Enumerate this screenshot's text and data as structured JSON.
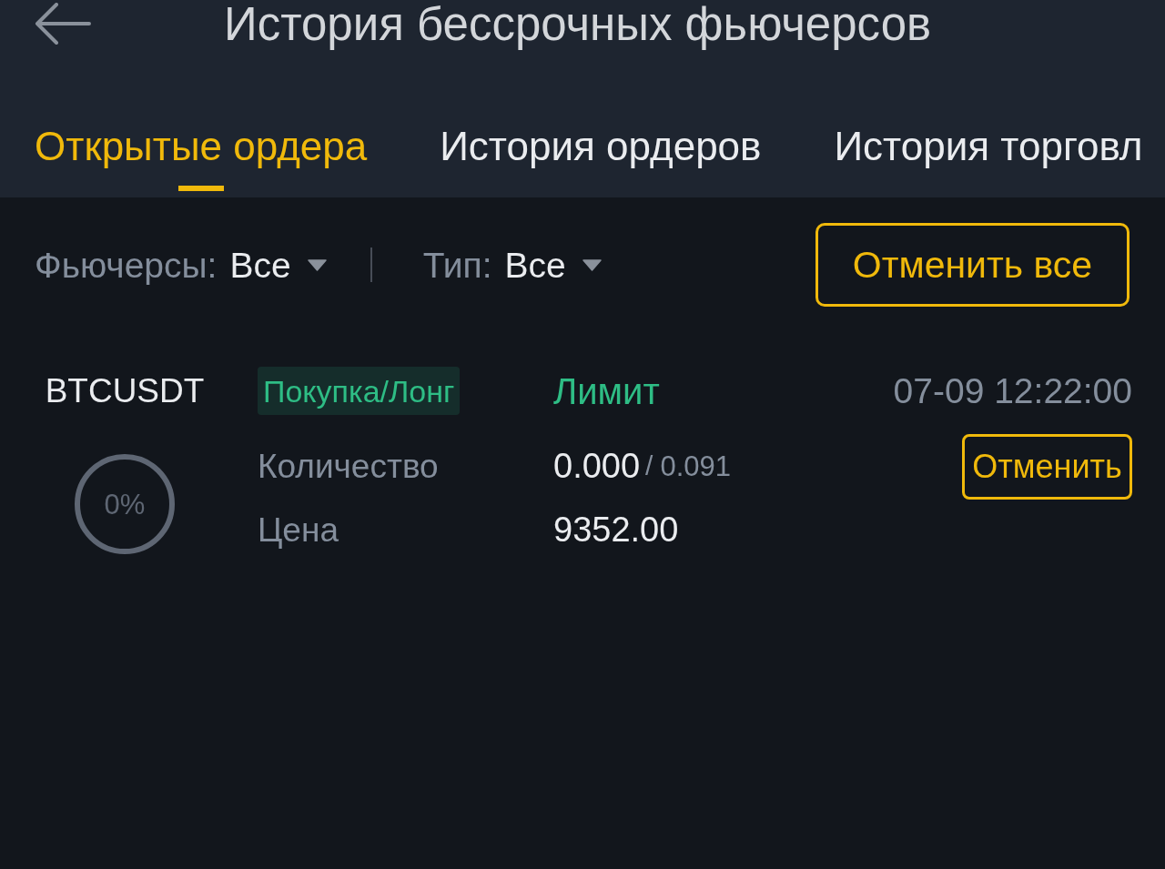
{
  "header": {
    "title": "История бессрочных фьючерсов"
  },
  "tabs": [
    {
      "label": "Открытые ордера",
      "selected": true
    },
    {
      "label": "История ордеров",
      "selected": false
    },
    {
      "label": "История торговл",
      "selected": false
    }
  ],
  "filters": [
    {
      "label": "Фьючерсы:",
      "value": "Все"
    },
    {
      "label": "Тип:",
      "value": "Все"
    }
  ],
  "cancel_all_button": "Отменить все",
  "orders": [
    {
      "symbol": "BTCUSDT",
      "progress": {
        "reading": "0%"
      },
      "side": {
        "label": "Покупка/Лонг",
        "color": "#2ebd85"
      },
      "type": "Лимит",
      "time": "07-09 12:22:00",
      "fields": [
        {
          "label": "Количество",
          "value": "0.000",
          "separator": "/",
          "total": "0.091"
        },
        {
          "label": "Цена",
          "value": "9352.00"
        }
      ],
      "cancel_button": "Отменить"
    }
  ]
}
